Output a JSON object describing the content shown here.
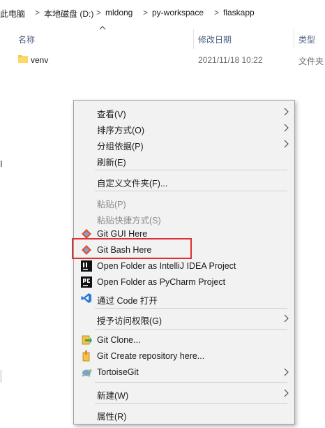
{
  "breadcrumb": {
    "items": [
      "此电脑",
      "本地磁盘 (D:)",
      "mldong",
      "py-workspace",
      "flaskapp"
    ],
    "separator": ">"
  },
  "columns": {
    "name": "名称",
    "date": "修改日期",
    "type": "类型"
  },
  "files": [
    {
      "name": "venv",
      "date": "2021/11/18 10:22",
      "type": "文件夹",
      "icon": "folder-icon"
    }
  ],
  "left_fragment": "Ⅰ",
  "context_menu": {
    "view": "查看(V)",
    "sort": "排序方式(O)",
    "group": "分组依据(P)",
    "refresh": "刷新(E)",
    "customize": "自定义文件夹(F)...",
    "paste": "粘贴(P)",
    "paste_shortcut": "粘贴快捷方式(S)",
    "git_gui": "Git GUI Here",
    "git_bash": "Git Bash Here",
    "intellij": "Open Folder as IntelliJ IDEA Project",
    "pycharm": "Open Folder as PyCharm Project",
    "vscode": "通过 Code 打开",
    "grant_access": "授予访问权限(G)",
    "git_clone": "Git Clone...",
    "git_create": "Git Create repository here...",
    "tortoise": "TortoiseGit",
    "new": "新建(W)",
    "properties": "属性(R)"
  },
  "colors": {
    "menu_bg": "#f2f2f2",
    "highlight_border": "#e03030",
    "header_text": "#4d6082",
    "folder": "#f6c94e",
    "vscode_blue": "#2b7bd6"
  }
}
